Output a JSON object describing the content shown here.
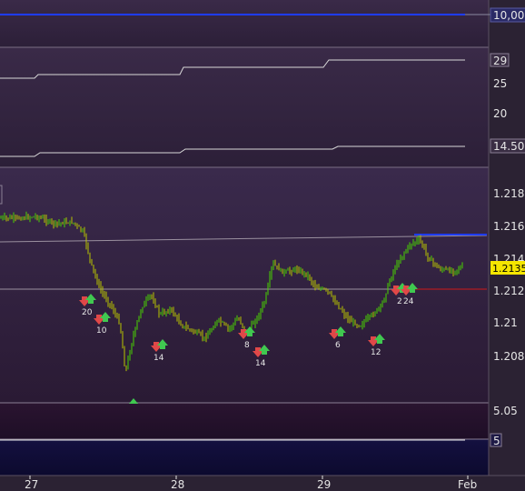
{
  "colors": {
    "up_candle": "#48d400",
    "down_candle": "#b8c400",
    "grid": "#6a5f74",
    "ma_line": "#9a909f",
    "blue_line": "#1e3cff",
    "red_line": "#d01818",
    "sell_arrow": "#e04848",
    "buy_arrow": "#40c850",
    "price_box_bg": "#f5e600"
  },
  "chart_data": [
    {
      "type": "line",
      "pane": "top",
      "series": [
        {
          "values": [
            10000,
            10000
          ]
        }
      ],
      "y_labels": [
        "10,000"
      ]
    },
    {
      "type": "line",
      "pane": "middle",
      "x": [
        "27",
        "27.5",
        "28",
        "28.5",
        "29",
        "29.5",
        "Feb"
      ],
      "series": [
        {
          "values": [
            25.5,
            25.5,
            27,
            27,
            28.5,
            29,
            29
          ]
        },
        {
          "values": [
            13.5,
            13.5,
            14,
            14,
            14.5,
            14.5,
            14.5
          ]
        }
      ],
      "y_ticks": [
        "29",
        "25",
        "20",
        "14.500"
      ]
    },
    {
      "type": "candlestick",
      "pane": "price",
      "x_ticks": [
        "27",
        "28",
        "29",
        "Feb"
      ],
      "y_ticks": [
        "1.218",
        "1.216",
        "1.214",
        "1.2135",
        "1.212",
        "1.21",
        "1.208"
      ],
      "last_price": "1.2135",
      "annotations": [
        {
          "text": "20",
          "kind": "sell-buy"
        },
        {
          "text": "10",
          "kind": "sell-buy"
        },
        {
          "text": "14",
          "kind": "sell-buy"
        },
        {
          "text": "8",
          "kind": "sell-buy"
        },
        {
          "text": "14",
          "kind": "sell-buy"
        },
        {
          "text": "6",
          "kind": "sell-buy"
        },
        {
          "text": "12",
          "kind": "sell-buy"
        },
        {
          "text": "2",
          "kind": "sell-buy"
        },
        {
          "text": "24",
          "kind": "sell-buy"
        }
      ]
    },
    {
      "type": "line",
      "pane": "bottom",
      "y_ticks": [
        "5.05",
        "5"
      ]
    }
  ]
}
